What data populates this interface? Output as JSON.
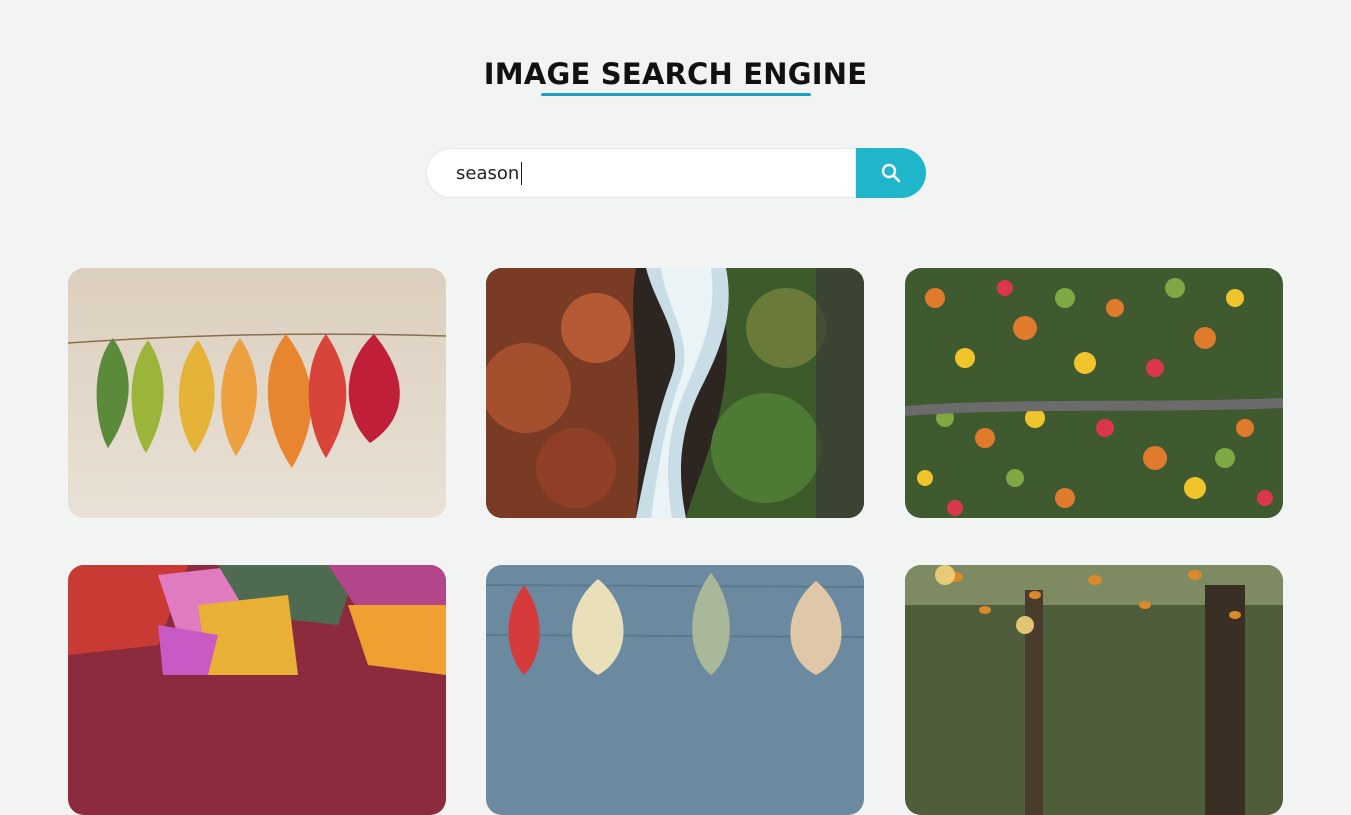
{
  "header": {
    "title": "IMAGE SEARCH ENGINE",
    "accent_color": "#1aa3c3"
  },
  "search": {
    "value": "season",
    "button_icon": "search-icon",
    "button_color": "#1fb5cb"
  },
  "gallery": {
    "images": [
      {
        "name": "autumn-leaves-on-string"
      },
      {
        "name": "river-through-autumn-forest"
      },
      {
        "name": "aerial-road-through-autumn-forest"
      },
      {
        "name": "colorful-fallen-leaves"
      },
      {
        "name": "leaves-on-wooden-boards"
      },
      {
        "name": "falling-leaves-in-forest"
      }
    ]
  }
}
